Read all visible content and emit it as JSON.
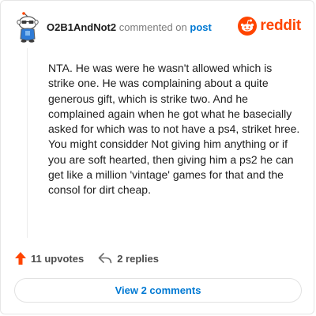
{
  "header": {
    "username": "O2B1AndNot2",
    "commented_on": "commented on",
    "post": "post"
  },
  "brand": {
    "wordmark": "reddit",
    "icon": "reddit-snoo-icon",
    "color": "#ff4500"
  },
  "comment": {
    "paragraph_1": "NTA. He was were he wasn't allowed which is strike one. He was complaining about a quite generous gift, which is strike two. And he complained again when he got what he basecially asked for which was to not have a ps4, striket hree.",
    "paragraph_2": "You might considder Not giving him anything or if you are soft hearted, then giving him a ps2 he can get like a million 'vintage' games for that and the consol for dirt cheap."
  },
  "actions": {
    "upvotes": "11 upvotes",
    "replies": "2 replies",
    "upvote_icon": "upvote-arrow-icon",
    "reply_icon": "reply-arrow-icon",
    "upvote_color": "#ff4500"
  },
  "view_button": {
    "label": "View 2 comments",
    "color": "#0079d3"
  }
}
